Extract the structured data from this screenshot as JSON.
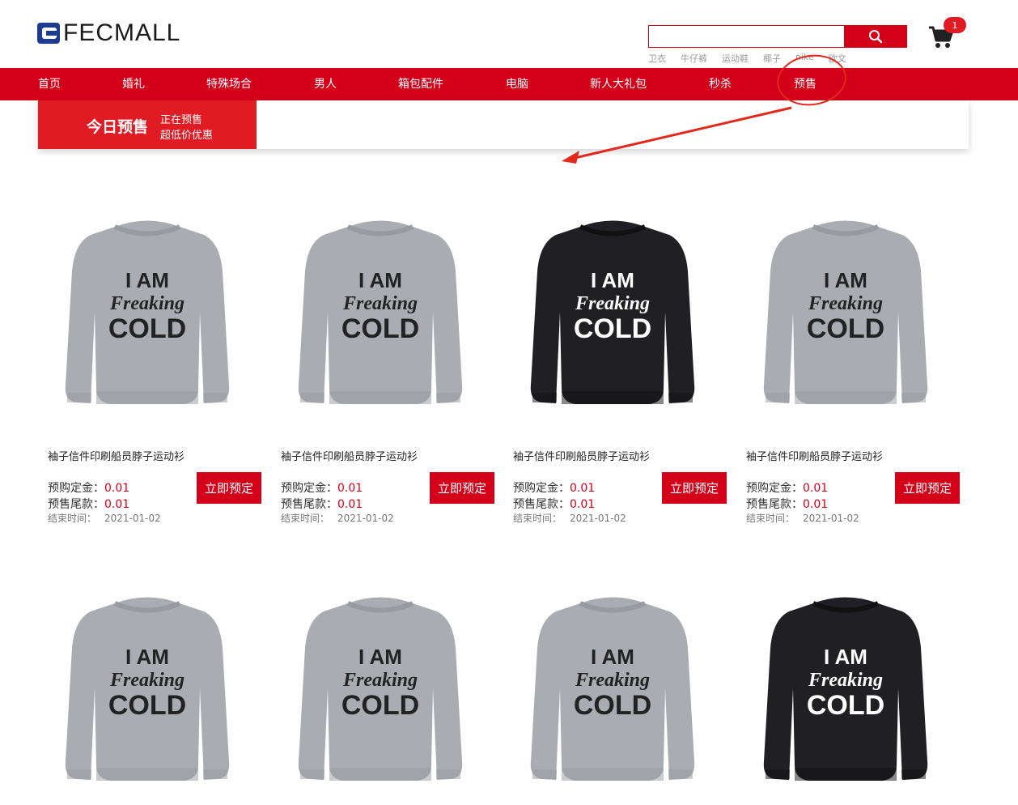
{
  "header": {
    "logo_text": "FECMALL",
    "search_placeholder": "",
    "hot_words": [
      "卫衣",
      "牛仔裤",
      "运动鞋",
      "椰子",
      "nike",
      "欧文"
    ],
    "cart_count": "1"
  },
  "nav": {
    "items": [
      "首页",
      "婚礼",
      "特殊场合",
      "男人",
      "箱包配件",
      "电脑",
      "新人大礼包",
      "秒杀",
      "预售"
    ]
  },
  "presale": {
    "title": "今日预售",
    "sub1": "正在预售",
    "sub2": "超低价优惠"
  },
  "products": [
    {
      "name": "袖子信件印刷船员脖子运动衫",
      "deposit_label": "预购定金：",
      "deposit": "0.01",
      "final_label": "预售尾款：",
      "final": "0.01",
      "end_label": "结束时间：",
      "end": "2021-01-02",
      "button": "立即预定",
      "color": "gray"
    },
    {
      "name": "袖子信件印刷船员脖子运动衫",
      "deposit_label": "预购定金：",
      "deposit": "0.01",
      "final_label": "预售尾款：",
      "final": "0.01",
      "end_label": "结束时间：",
      "end": "2021-01-02",
      "button": "立即预定",
      "color": "gray"
    },
    {
      "name": "袖子信件印刷船员脖子运动衫",
      "deposit_label": "预购定金：",
      "deposit": "0.01",
      "final_label": "预售尾款：",
      "final": "0.01",
      "end_label": "结束时间：",
      "end": "2021-01-02",
      "button": "立即预定",
      "color": "black"
    },
    {
      "name": "袖子信件印刷船员脖子运动衫",
      "deposit_label": "预购定金：",
      "deposit": "0.01",
      "final_label": "预售尾款：",
      "final": "0.01",
      "end_label": "结束时间：",
      "end": "2021-01-02",
      "button": "立即预定",
      "color": "gray"
    },
    {
      "color": "gray"
    },
    {
      "color": "gray"
    },
    {
      "color": "gray"
    },
    {
      "color": "black"
    }
  ],
  "shirt_print": {
    "line1": "I AM",
    "line2": "Freaking",
    "line3": "COLD"
  },
  "colors": {
    "brand_red": "#d4001a",
    "logo_blue": "#1d3b8f",
    "shirt_gray": "#a9acb1",
    "shirt_black": "#1f1f24"
  }
}
